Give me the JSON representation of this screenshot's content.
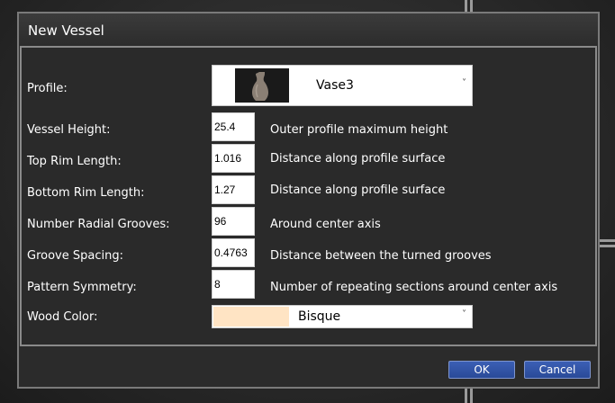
{
  "dialog": {
    "title": "New Vessel"
  },
  "profile": {
    "label": "Profile:",
    "selected": "Vase3",
    "thumbnail_icon": "vase-icon"
  },
  "fields": [
    {
      "label": "Vessel Height:",
      "value": "25.4",
      "description": "Outer profile maximum height"
    },
    {
      "label": "Top Rim Length:",
      "value": "1.016",
      "description": "Distance along profile surface"
    },
    {
      "label": "Bottom Rim Length:",
      "value": "1.27",
      "description": "Distance along profile surface"
    },
    {
      "label": "Number Radial Grooves:",
      "value": "96",
      "description": "Around center axis"
    },
    {
      "label": "Groove Spacing:",
      "value": "0.4763",
      "description": "Distance between the turned grooves"
    },
    {
      "label": "Pattern Symmetry:",
      "value": "8",
      "description": "Number of repeating sections around center axis"
    }
  ],
  "wood_color": {
    "label": "Wood Color:",
    "selected": "Bisque",
    "swatch_color": "#FFE4C4"
  },
  "buttons": {
    "ok": "OK",
    "cancel": "Cancel"
  },
  "chevron_glyph": "˅"
}
